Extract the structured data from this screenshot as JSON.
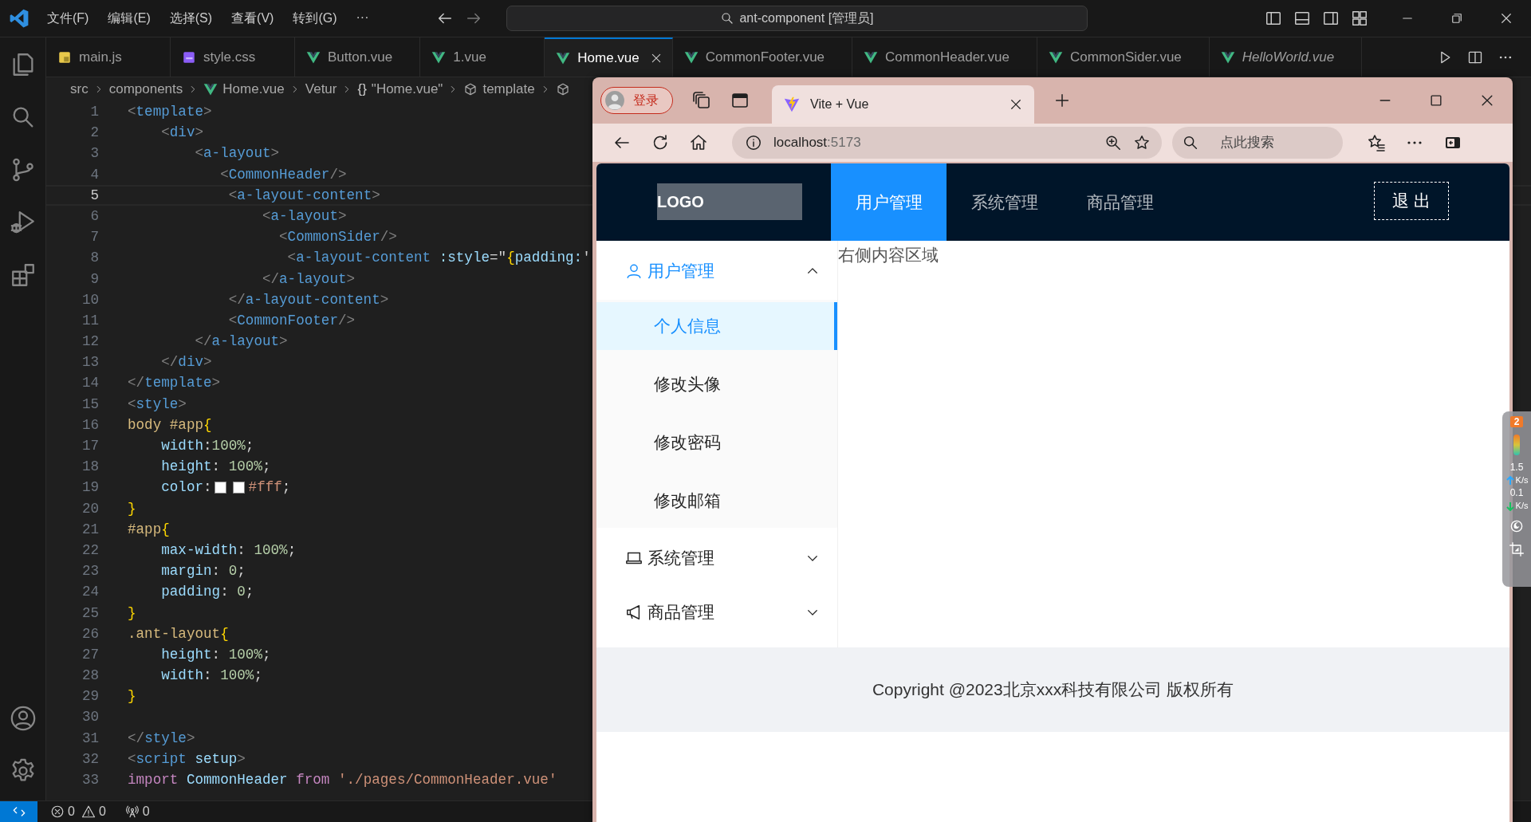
{
  "title_bar": {
    "menus": [
      "文件(F)",
      "编辑(E)",
      "选择(S)",
      "查看(V)",
      "转到(G)"
    ],
    "overflow": "···",
    "command_center": "ant-component [管理员]"
  },
  "editor_tabs": [
    {
      "label": "main.js",
      "kind": "js",
      "selected": false,
      "italic": false
    },
    {
      "label": "style.css",
      "kind": "css",
      "selected": false,
      "italic": false
    },
    {
      "label": "Button.vue",
      "kind": "vue",
      "selected": false,
      "italic": false
    },
    {
      "label": "1.vue",
      "kind": "vue",
      "selected": false,
      "italic": false
    },
    {
      "label": "Home.vue",
      "kind": "vue",
      "selected": true,
      "italic": false
    },
    {
      "label": "CommonFooter.vue",
      "kind": "vue",
      "selected": false,
      "italic": false
    },
    {
      "label": "CommonHeader.vue",
      "kind": "vue",
      "selected": false,
      "italic": false
    },
    {
      "label": "CommonSider.vue",
      "kind": "vue",
      "selected": false,
      "italic": false
    },
    {
      "label": "HelloWorld.vue",
      "kind": "vue",
      "selected": false,
      "italic": true
    }
  ],
  "breadcrumb": [
    {
      "label": "src",
      "kind": "folder"
    },
    {
      "label": "components",
      "kind": "folder"
    },
    {
      "label": "Home.vue",
      "kind": "vue"
    },
    {
      "label": "Vetur",
      "kind": "folder"
    },
    {
      "label": "\"Home.vue\"",
      "kind": "object",
      "icon_text": "{}"
    },
    {
      "label": "template",
      "kind": "element"
    },
    {
      "kind": "element"
    }
  ],
  "code": {
    "lines": [
      {
        "number": "1",
        "selected": false,
        "tokens": [
          {
            "kind": "punct",
            "text": "<"
          },
          {
            "kind": "tag",
            "text": "template"
          },
          {
            "kind": "punct",
            "text": ">"
          }
        ]
      },
      {
        "number": "2",
        "selected": false,
        "tokens": [
          {
            "kind": "punct",
            "text": "    <"
          },
          {
            "kind": "tag",
            "text": "div"
          },
          {
            "kind": "punct",
            "text": ">"
          }
        ]
      },
      {
        "number": "3",
        "selected": false,
        "tokens": [
          {
            "kind": "punct",
            "text": "        <"
          },
          {
            "kind": "tag",
            "text": "a-layout"
          },
          {
            "kind": "punct",
            "text": ">"
          }
        ]
      },
      {
        "number": "4",
        "selected": false,
        "tokens": [
          {
            "kind": "punct",
            "text": "           <"
          },
          {
            "kind": "tag",
            "text": "CommonHeader"
          },
          {
            "kind": "punct",
            "text": "/>"
          }
        ]
      },
      {
        "number": "5",
        "selected": true,
        "tokens": [
          {
            "kind": "punct",
            "text": "            <"
          },
          {
            "kind": "tag",
            "text": "a-layout-content"
          },
          {
            "kind": "punct",
            "text": ">"
          }
        ]
      },
      {
        "number": "6",
        "selected": false,
        "tokens": [
          {
            "kind": "punct",
            "text": "                <"
          },
          {
            "kind": "tag",
            "text": "a-layout"
          },
          {
            "kind": "punct",
            "text": ">"
          }
        ]
      },
      {
        "number": "7",
        "selected": false,
        "tokens": [
          {
            "kind": "punct",
            "text": "                  <"
          },
          {
            "kind": "tag",
            "text": "CommonSider"
          },
          {
            "kind": "punct",
            "text": "/>"
          }
        ]
      },
      {
        "number": "8",
        "selected": false,
        "tokens": [
          {
            "kind": "punct",
            "text": "                   <"
          },
          {
            "kind": "tag",
            "text": "a-layout-content"
          },
          {
            "kind": "attr",
            "text": " :style"
          },
          {
            "kind": "plain",
            "text": "=\""
          },
          {
            "kind": "brace",
            "text": "{"
          },
          {
            "kind": "attr",
            "text": "padding:"
          },
          {
            "kind": "plain",
            "text": "'"
          }
        ]
      },
      {
        "number": "9",
        "selected": false,
        "tokens": [
          {
            "kind": "punct",
            "text": "                </"
          },
          {
            "kind": "tag",
            "text": "a-layout"
          },
          {
            "kind": "punct",
            "text": ">"
          }
        ]
      },
      {
        "number": "10",
        "selected": false,
        "tokens": [
          {
            "kind": "punct",
            "text": "            </"
          },
          {
            "kind": "tag",
            "text": "a-layout-content"
          },
          {
            "kind": "punct",
            "text": ">"
          }
        ]
      },
      {
        "number": "11",
        "selected": false,
        "tokens": [
          {
            "kind": "punct",
            "text": "            <"
          },
          {
            "kind": "tag",
            "text": "CommonFooter"
          },
          {
            "kind": "punct",
            "text": "/>"
          }
        ]
      },
      {
        "number": "12",
        "selected": false,
        "tokens": [
          {
            "kind": "punct",
            "text": "        </"
          },
          {
            "kind": "tag",
            "text": "a-layout"
          },
          {
            "kind": "punct",
            "text": ">"
          }
        ]
      },
      {
        "number": "13",
        "selected": false,
        "tokens": [
          {
            "kind": "punct",
            "text": "    </"
          },
          {
            "kind": "tag",
            "text": "div"
          },
          {
            "kind": "punct",
            "text": ">"
          }
        ]
      },
      {
        "number": "14",
        "selected": false,
        "tokens": [
          {
            "kind": "punct",
            "text": "</"
          },
          {
            "kind": "tag",
            "text": "template"
          },
          {
            "kind": "punct",
            "text": ">"
          }
        ]
      },
      {
        "number": "15",
        "selected": false,
        "tokens": [
          {
            "kind": "punct",
            "text": "<"
          },
          {
            "kind": "tag",
            "text": "style"
          },
          {
            "kind": "punct",
            "text": ">"
          }
        ]
      },
      {
        "number": "16",
        "selected": false,
        "tokens": [
          {
            "kind": "selector",
            "text": "body #app"
          },
          {
            "kind": "brace",
            "text": "{"
          }
        ]
      },
      {
        "number": "17",
        "selected": false,
        "tokens": [
          {
            "kind": "prop",
            "text": "    width"
          },
          {
            "kind": "plain",
            "text": ":"
          },
          {
            "kind": "num",
            "text": "100%"
          },
          {
            "kind": "plain",
            "text": ";"
          }
        ]
      },
      {
        "number": "18",
        "selected": false,
        "tokens": [
          {
            "kind": "prop",
            "text": "    height"
          },
          {
            "kind": "plain",
            "text": ":"
          },
          {
            "kind": "num",
            "text": " 100%"
          },
          {
            "kind": "plain",
            "text": ";"
          }
        ]
      },
      {
        "number": "19",
        "selected": false,
        "tokens": [
          {
            "kind": "prop",
            "text": "    color"
          },
          {
            "kind": "plain",
            "text": ":"
          },
          {
            "kind": "swatch",
            "color": "#ffffff"
          },
          {
            "kind": "swatch",
            "color": "#ffffff"
          },
          {
            "kind": "str",
            "text": "#fff"
          },
          {
            "kind": "plain",
            "text": ";"
          }
        ]
      },
      {
        "number": "20",
        "selected": false,
        "tokens": [
          {
            "kind": "brace",
            "text": "}"
          }
        ]
      },
      {
        "number": "21",
        "selected": false,
        "tokens": [
          {
            "kind": "selector",
            "text": "#app"
          },
          {
            "kind": "brace",
            "text": "{"
          }
        ]
      },
      {
        "number": "22",
        "selected": false,
        "tokens": [
          {
            "kind": "prop",
            "text": "    max-width"
          },
          {
            "kind": "plain",
            "text": ":"
          },
          {
            "kind": "num",
            "text": " 100%"
          },
          {
            "kind": "plain",
            "text": ";"
          }
        ]
      },
      {
        "number": "23",
        "selected": false,
        "tokens": [
          {
            "kind": "prop",
            "text": "    margin"
          },
          {
            "kind": "plain",
            "text": ":"
          },
          {
            "kind": "num",
            "text": " 0"
          },
          {
            "kind": "plain",
            "text": ";"
          }
        ]
      },
      {
        "number": "24",
        "selected": false,
        "tokens": [
          {
            "kind": "prop",
            "text": "    padding"
          },
          {
            "kind": "plain",
            "text": ":"
          },
          {
            "kind": "num",
            "text": " 0"
          },
          {
            "kind": "plain",
            "text": ";"
          }
        ]
      },
      {
        "number": "25",
        "selected": false,
        "tokens": [
          {
            "kind": "brace",
            "text": "}"
          }
        ]
      },
      {
        "number": "26",
        "selected": false,
        "tokens": [
          {
            "kind": "selector",
            "text": ".ant-layout"
          },
          {
            "kind": "brace",
            "text": "{"
          }
        ]
      },
      {
        "number": "27",
        "selected": false,
        "tokens": [
          {
            "kind": "prop",
            "text": "    height"
          },
          {
            "kind": "plain",
            "text": ":"
          },
          {
            "kind": "num",
            "text": " 100%"
          },
          {
            "kind": "plain",
            "text": ";"
          }
        ]
      },
      {
        "number": "28",
        "selected": false,
        "tokens": [
          {
            "kind": "prop",
            "text": "    width"
          },
          {
            "kind": "plain",
            "text": ":"
          },
          {
            "kind": "num",
            "text": " 100%"
          },
          {
            "kind": "plain",
            "text": ";"
          }
        ]
      },
      {
        "number": "29",
        "selected": false,
        "tokens": [
          {
            "kind": "brace",
            "text": "}"
          }
        ]
      },
      {
        "number": "30",
        "selected": false
      },
      {
        "number": "31",
        "selected": false,
        "tokens": [
          {
            "kind": "punct",
            "text": "</"
          },
          {
            "kind": "tag",
            "text": "style"
          },
          {
            "kind": "punct",
            "text": ">"
          }
        ]
      },
      {
        "number": "32",
        "selected": false,
        "tokens": [
          {
            "kind": "punct",
            "text": "<"
          },
          {
            "kind": "tag",
            "text": "script"
          },
          {
            "kind": "attr",
            "text": " setup"
          },
          {
            "kind": "punct",
            "text": ">"
          }
        ]
      },
      {
        "number": "33",
        "selected": false,
        "tokens": [
          {
            "kind": "keyword",
            "text": "import"
          },
          {
            "kind": "var",
            "text": " CommonHeader"
          },
          {
            "kind": "keyword",
            "text": " from"
          },
          {
            "kind": "str",
            "text": " './pages/CommonHeader.vue'"
          }
        ]
      }
    ]
  },
  "status_bar": {
    "errors": "0",
    "warnings": "0",
    "ports": "0"
  },
  "browser": {
    "profile_button": "登录",
    "tab_title": "Vite + Vue",
    "address": {
      "host": "localhost",
      "port": ":5173"
    },
    "search": {
      "placeholder": "点此搜索"
    }
  },
  "app": {
    "logo": "LOGO",
    "nav": [
      {
        "label": "用户管理",
        "selected": true
      },
      {
        "label": "系统管理",
        "selected": false
      },
      {
        "label": "商品管理",
        "selected": false
      }
    ],
    "logout": "退 出",
    "side_menu": [
      {
        "label": "用户管理",
        "kind": "user",
        "expanded": true,
        "children": [
          {
            "label": "个人信息",
            "selected": true
          },
          {
            "label": "修改头像",
            "selected": false
          },
          {
            "label": "修改密码",
            "selected": false
          },
          {
            "label": "修改邮箱",
            "selected": false
          }
        ]
      },
      {
        "label": "系统管理",
        "kind": "laptop",
        "expanded": false
      },
      {
        "label": "商品管理",
        "kind": "notification",
        "expanded": false
      }
    ],
    "content_text": "右侧内容区域",
    "footer": "Copyright @2023北京xxx科技有限公司 版权所有"
  },
  "net_widget": {
    "badge": "2",
    "upload": "1.5",
    "upload_unit": "K/s",
    "download": "0.1",
    "download_unit": "K/s"
  }
}
